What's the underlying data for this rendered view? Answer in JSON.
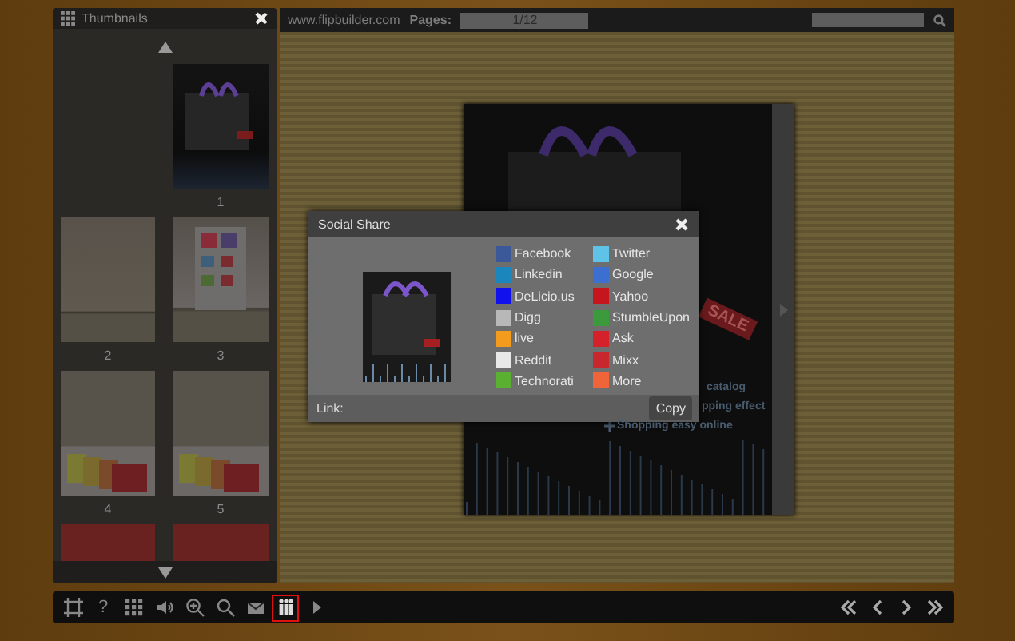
{
  "thumbnails": {
    "title": "Thumbnails",
    "pages": [
      {
        "kind": "blank"
      },
      {
        "kind": "cover",
        "number": "1"
      },
      {
        "kind": "contents",
        "number": "2"
      },
      {
        "kind": "sale",
        "number": "3"
      },
      {
        "kind": "text",
        "number": "4"
      },
      {
        "kind": "photos",
        "number": "5"
      },
      {
        "kind": "red"
      },
      {
        "kind": "red"
      }
    ]
  },
  "top_bar": {
    "site": "www.flipbuilder.com",
    "pages_label": "Pages:",
    "page_value": "1/12"
  },
  "page": {
    "tag": "SALE",
    "lines": [
      "catalog",
      "pping effect",
      "Shopping easy online"
    ]
  },
  "social_share": {
    "title": "Social Share",
    "services": [
      {
        "name": "Facebook",
        "color": "#3b5998"
      },
      {
        "name": "Twitter",
        "color": "#5fc3e8"
      },
      {
        "name": "Linkedin",
        "color": "#1b86bc"
      },
      {
        "name": "Google",
        "color": "#3d6fd1"
      },
      {
        "name": "DeLicio.us",
        "color": "#1111ee"
      },
      {
        "name": "Yahoo",
        "color": "#c4161c"
      },
      {
        "name": "Digg",
        "color": "#b8b8b8"
      },
      {
        "name": "StumbleUpon",
        "color": "#3c9a3c"
      },
      {
        "name": "live",
        "color": "#f29b1d"
      },
      {
        "name": "Ask",
        "color": "#d5222a"
      },
      {
        "name": "Reddit",
        "color": "#e8e8e8"
      },
      {
        "name": "Mixx",
        "color": "#c8272d"
      },
      {
        "name": "Technorati",
        "color": "#5ab031"
      },
      {
        "name": "More",
        "color": "#f0643a"
      }
    ],
    "link_label": "Link:",
    "copy_button": "Copy"
  },
  "toolbar": {
    "tools": [
      {
        "kind": "fit",
        "selected": false
      },
      {
        "kind": "help",
        "label": "?",
        "selected": false
      },
      {
        "kind": "grid",
        "selected": false
      },
      {
        "kind": "sound",
        "selected": false
      },
      {
        "kind": "zoom",
        "selected": false
      },
      {
        "kind": "search",
        "selected": false
      },
      {
        "kind": "mail",
        "selected": false
      },
      {
        "kind": "share",
        "selected": true
      },
      {
        "kind": "play",
        "selected": false
      }
    ],
    "nav": [
      {
        "kind": "first"
      },
      {
        "kind": "prev"
      },
      {
        "kind": "next"
      },
      {
        "kind": "last"
      }
    ]
  }
}
